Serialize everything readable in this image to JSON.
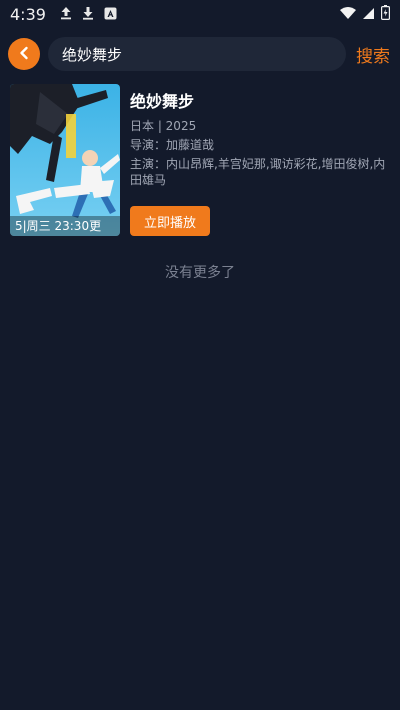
{
  "status_bar": {
    "time": "4:39",
    "left_icons": [
      "upload-icon",
      "download-icon",
      "a-box-icon"
    ],
    "right_icons": [
      "wifi-icon",
      "signal-icon",
      "battery-icon"
    ]
  },
  "search": {
    "back_icon": "chevron-left-icon",
    "query": "绝妙舞步",
    "button_label": "搜索"
  },
  "result": {
    "title": "绝妙舞步",
    "region_year": "日本 | 2025",
    "director": "导演：加藤道哉",
    "cast": "主演：内山昂辉,羊宫妃那,诹访彩花,增田俊树,内田雄马",
    "poster_tag": "5|周三 23:30更",
    "play_label": "立即播放"
  },
  "footer": {
    "no_more": "没有更多了"
  },
  "colors": {
    "background": "#131a2b",
    "accent": "#f07a1c",
    "input_bg": "#1f2738"
  }
}
